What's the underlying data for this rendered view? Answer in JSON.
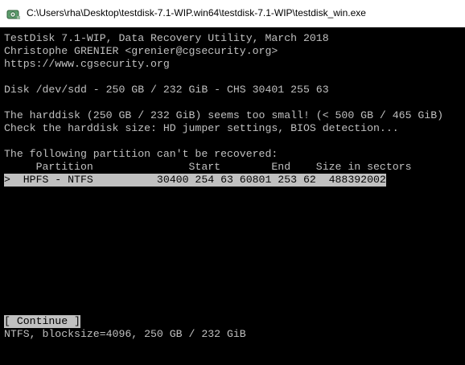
{
  "window": {
    "title": "C:\\Users\\rha\\Desktop\\testdisk-7.1-WIP.win64\\testdisk-7.1-WIP\\testdisk_win.exe",
    "icon": "testdisk-app-icon"
  },
  "header": {
    "line1": "TestDisk 7.1-WIP, Data Recovery Utility, March 2018",
    "line2": "Christophe GRENIER <grenier@cgsecurity.org>",
    "line3": "https://www.cgsecurity.org"
  },
  "disk": {
    "info": "Disk /dev/sdd - 250 GB / 232 GiB - CHS 30401 255 63"
  },
  "warning": {
    "line1": "The harddisk (250 GB / 232 GiB) seems too small! (< 500 GB / 465 GiB)",
    "line2": "Check the harddisk size: HD jumper settings, BIOS detection..."
  },
  "partitions": {
    "message": "The following partition can't be recovered:",
    "header": "     Partition               Start        End    Size in sectors",
    "rows": [
      {
        "text": ">  HPFS - NTFS          30400 254 63 60801 253 62  488392002"
      }
    ]
  },
  "actions": {
    "continue_label": "[ Continue ]"
  },
  "status": {
    "text": "NTFS, blocksize=4096, 250 GB / 232 GiB"
  },
  "colors": {
    "terminal_bg": "#000000",
    "terminal_fg": "#c0c0c0",
    "highlight_bg": "#c0c0c0",
    "highlight_fg": "#000000"
  }
}
